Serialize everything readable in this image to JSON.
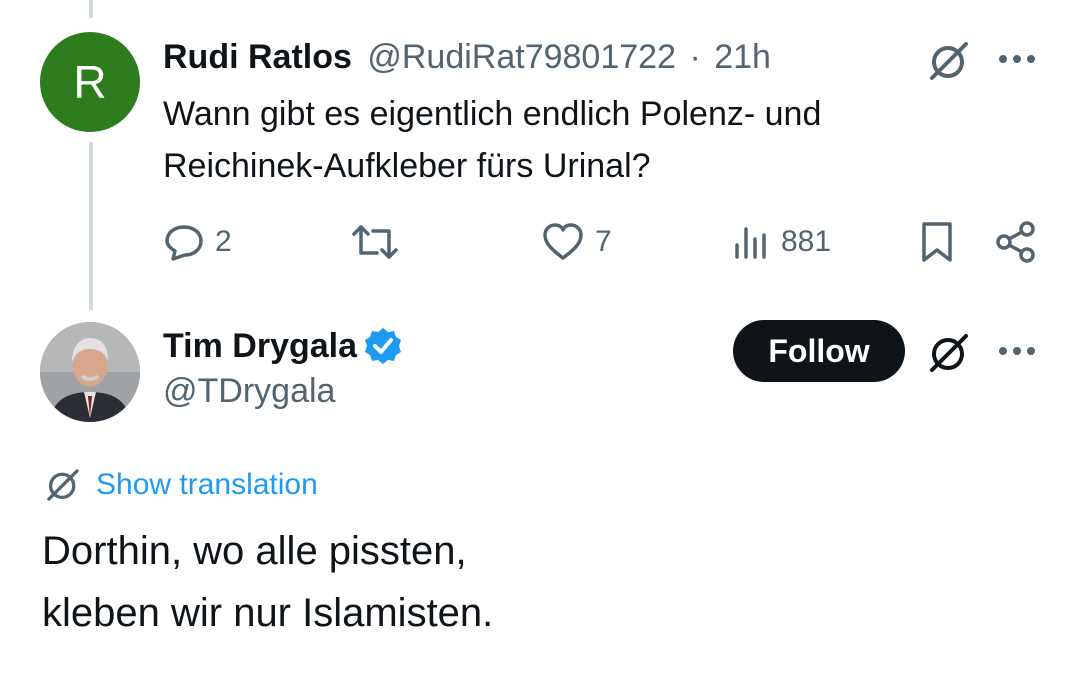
{
  "reply": {
    "avatar_letter": "R",
    "avatar_color": "#2d7d1e",
    "name": "Rudi Ratlos",
    "handle": "@RudiRat79801722",
    "separator": "·",
    "time": "21h",
    "text_line1": "Wann gibt es eigentlich endlich Polenz- und",
    "text_line2": "Reichinek-Aufkleber fürs Urinal?",
    "replies_count": "2",
    "likes_count": "7",
    "views_count": "881"
  },
  "main_tweet": {
    "name": "Tim Drygala",
    "handle": "@TDrygala",
    "verified_color": "#1d9bf0",
    "follow_label": "Follow",
    "show_translation_label": "Show translation",
    "text_line1": "Dorthin, wo alle pissten,",
    "text_line2": "kleben wir nur Islamisten."
  },
  "icons": {
    "translate": "grok-icon",
    "more": "more-icon",
    "reply": "reply-icon",
    "retweet": "retweet-icon",
    "like": "heart-icon",
    "views": "views-icon",
    "bookmark": "bookmark-icon",
    "share": "share-icon"
  },
  "colors": {
    "text": "#0f1419",
    "muted": "#536471",
    "accent": "#1d9bf0",
    "thread_line": "#cfd9de"
  }
}
